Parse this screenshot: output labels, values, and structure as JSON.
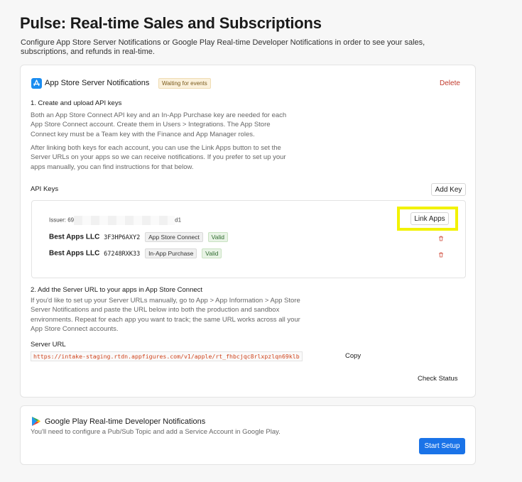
{
  "page": {
    "title": "Pulse: Real-time Sales and Subscriptions",
    "subtitle": "Configure App Store Server Notifications or Google Play Real-time Developer Notifications in order to see your sales, subscriptions, and refunds in real-time."
  },
  "appstore": {
    "title": "App Store Server Notifications",
    "status_badge": "Waiting for events",
    "delete_label": "Delete",
    "step1_title": "1. Create and upload API keys",
    "step1_p1": "Both an App Store Connect API key and an In-App Purchase key are needed for each App Store Connect account. Create them in Users > Integrations. The App Store Connect key must be a Team key with the Finance and App Manager roles.",
    "step1_p2": "After linking both keys for each account, you can use the Link Apps button to set the Server URLs on your apps so we can receive notifications. If you prefer to set up your apps manually, you can find instructions for that below.",
    "api_keys_label": "API Keys",
    "add_key_label": "Add Key",
    "issuer_prefix": "Issuer: 69",
    "issuer_suffix": "d1",
    "link_apps_label": "Link Apps",
    "keys": [
      {
        "account": "Best Apps LLC",
        "key_id": "3F3HP6AXY2",
        "type": "App Store Connect",
        "status": "Valid"
      },
      {
        "account": "Best Apps LLC",
        "key_id": "67248RXK33",
        "type": "In-App Purchase",
        "status": "Valid"
      }
    ],
    "step2_title": "2. Add the Server URL to your apps in App Store Connect",
    "step2_p": "If you'd like to set up your Server URLs manually, go to App > App Information > App Store Server Notifications and paste the URL below into both the production and sandbox environments. Repeat for each app you want to track; the same URL works across all your App Store Connect accounts.",
    "server_url_label": "Server URL",
    "server_url": "https://intake-staging.rtdn.appfigures.com/v1/apple/rt_fhbcjqc8rlxpzlqn69klb",
    "copy_label": "Copy",
    "check_status_label": "Check Status"
  },
  "googleplay": {
    "title": "Google Play Real-time Developer Notifications",
    "description": "You'll need to configure a Pub/Sub Topic and add a Service Account in Google Play.",
    "start_setup_label": "Start Setup"
  },
  "colors": {
    "accent_blue": "#1a73e8",
    "delete_red": "#c0392b",
    "highlight_yellow": "#f2f200",
    "url_red": "#d0441c"
  },
  "icons": {
    "appstore": "app-store-icon",
    "googleplay": "google-play-icon",
    "trash": "trash-icon"
  }
}
